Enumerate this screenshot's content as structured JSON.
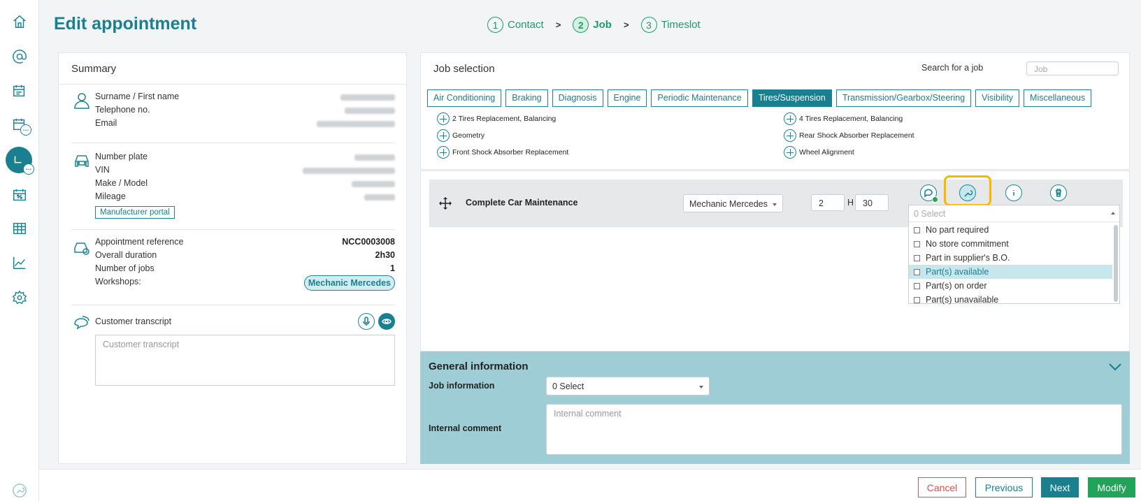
{
  "page_title": "Edit appointment",
  "steps": [
    {
      "num": "1",
      "label": "Contact"
    },
    {
      "num": "2",
      "label": "Job"
    },
    {
      "num": "3",
      "label": "Timeslot"
    }
  ],
  "step_separator": ">",
  "summary": {
    "title": "Summary",
    "contact": {
      "surname_label": "Surname / First name",
      "phone_label": "Telephone no.",
      "email_label": "Email"
    },
    "vehicle": {
      "plate_label": "Number plate",
      "vin_label": "VIN",
      "make_label": "Make / Model",
      "mileage_label": "Mileage",
      "portal_button": "Manufacturer portal"
    },
    "appointment": {
      "ref_label": "Appointment reference",
      "ref_value": "NCC0003008",
      "duration_label": "Overall duration",
      "duration_value": "2h30",
      "jobs_label": "Number of jobs",
      "jobs_value": "1",
      "workshops_label": "Workshops:",
      "workshop_pill": "Mechanic Mercedes"
    },
    "transcript": {
      "label": "Customer transcript",
      "placeholder": "Customer transcript"
    }
  },
  "job_selection": {
    "title": "Job selection",
    "search_label": "Search for a job",
    "search_placeholder": "Job",
    "tabs": [
      "Air Conditioning",
      "Braking",
      "Diagnosis",
      "Engine",
      "Periodic Maintenance",
      "Tires/Suspension",
      "Transmission/Gearbox/Steering",
      "Visibility",
      "Miscellaneous"
    ],
    "active_tab": "Tires/Suspension",
    "jobs_left": [
      "2 Tires Replacement, Balancing",
      "Geometry",
      "Front Shock Absorber Replacement"
    ],
    "jobs_right": [
      "4 Tires Replacement, Balancing",
      "Rear Shock Absorber Replacement",
      "Wheel Alignment"
    ]
  },
  "selected_job": {
    "name": "Complete Car Maintenance",
    "workshop": "Mechanic Mercedes",
    "hours": "2",
    "hours_unit": "H",
    "minutes": "30",
    "parts_dropdown": {
      "placeholder": "0 Select",
      "options": [
        "No part required",
        "No store commitment",
        "Part in supplier's B.O.",
        "Part(s) available",
        "Part(s) on order",
        "Part(s) unavailable"
      ],
      "highlighted": "Part(s) available"
    }
  },
  "general_info": {
    "title": "General information",
    "job_info_label": "Job information",
    "job_info_value": "0 Select",
    "internal_comment_label": "Internal comment",
    "internal_comment_placeholder": "Internal comment"
  },
  "footer": {
    "cancel": "Cancel",
    "previous": "Previous",
    "next": "Next",
    "modify": "Modify"
  },
  "colors": {
    "accent": "#1a7f8e",
    "step_green": "#1c9d66",
    "highlight": "#f5b800",
    "modify_green": "#22a35a",
    "cancel_red": "#d9534f"
  },
  "icons": [
    "home-icon",
    "at-icon",
    "calendar-list-icon",
    "calendar-more-icon",
    "appointment-icon",
    "calendar-percent-icon",
    "table-icon",
    "chart-icon",
    "settings-icon",
    "wrench-icon"
  ]
}
